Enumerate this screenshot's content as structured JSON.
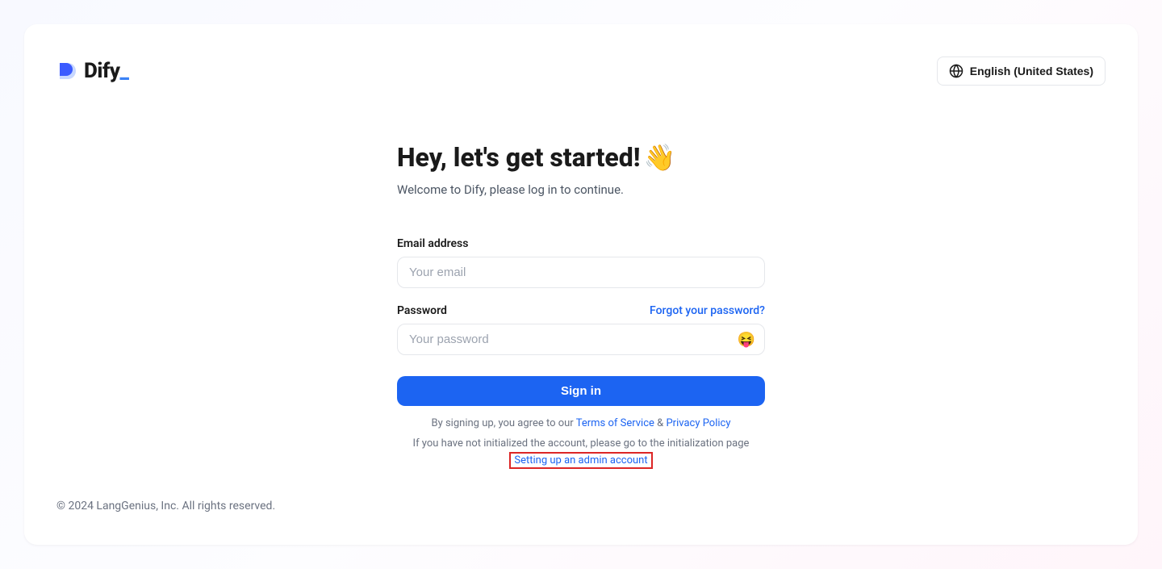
{
  "header": {
    "brand_name": "Dify",
    "language_label": "English (United States)"
  },
  "main": {
    "title_text": "Hey, let's get started!",
    "wave_emoji": "👋",
    "subtitle": "Welcome to Dify, please log in to continue.",
    "email_label": "Email address",
    "email_placeholder": "Your email",
    "email_value": "",
    "password_label": "Password",
    "password_placeholder": "Your password",
    "password_value": "",
    "forgot_password_label": "Forgot your password?",
    "toggle_password_emoji": "😝",
    "signin_label": "Sign in",
    "agreement_prefix": "By signing up, you agree to our ",
    "terms_label": "Terms of Service",
    "agreement_and": " & ",
    "privacy_label": "Privacy Policy",
    "init_prefix": "If you have not initialized the account, please go to the initialization page ",
    "init_link_label": "Setting up an admin account"
  },
  "footer": {
    "copyright": "© 2024 LangGenius, Inc. All rights reserved."
  }
}
